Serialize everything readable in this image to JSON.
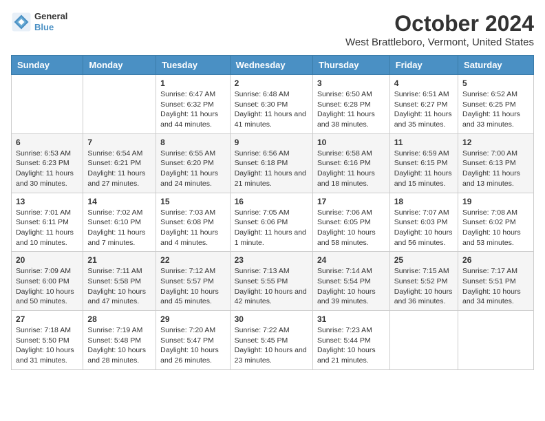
{
  "logo": {
    "line1": "General",
    "line2": "Blue"
  },
  "title": "October 2024",
  "subtitle": "West Brattleboro, Vermont, United States",
  "headers": [
    "Sunday",
    "Monday",
    "Tuesday",
    "Wednesday",
    "Thursday",
    "Friday",
    "Saturday"
  ],
  "weeks": [
    [
      {
        "day": "",
        "sunrise": "",
        "sunset": "",
        "daylight": ""
      },
      {
        "day": "",
        "sunrise": "",
        "sunset": "",
        "daylight": ""
      },
      {
        "day": "1",
        "sunrise": "Sunrise: 6:47 AM",
        "sunset": "Sunset: 6:32 PM",
        "daylight": "Daylight: 11 hours and 44 minutes."
      },
      {
        "day": "2",
        "sunrise": "Sunrise: 6:48 AM",
        "sunset": "Sunset: 6:30 PM",
        "daylight": "Daylight: 11 hours and 41 minutes."
      },
      {
        "day": "3",
        "sunrise": "Sunrise: 6:50 AM",
        "sunset": "Sunset: 6:28 PM",
        "daylight": "Daylight: 11 hours and 38 minutes."
      },
      {
        "day": "4",
        "sunrise": "Sunrise: 6:51 AM",
        "sunset": "Sunset: 6:27 PM",
        "daylight": "Daylight: 11 hours and 35 minutes."
      },
      {
        "day": "5",
        "sunrise": "Sunrise: 6:52 AM",
        "sunset": "Sunset: 6:25 PM",
        "daylight": "Daylight: 11 hours and 33 minutes."
      }
    ],
    [
      {
        "day": "6",
        "sunrise": "Sunrise: 6:53 AM",
        "sunset": "Sunset: 6:23 PM",
        "daylight": "Daylight: 11 hours and 30 minutes."
      },
      {
        "day": "7",
        "sunrise": "Sunrise: 6:54 AM",
        "sunset": "Sunset: 6:21 PM",
        "daylight": "Daylight: 11 hours and 27 minutes."
      },
      {
        "day": "8",
        "sunrise": "Sunrise: 6:55 AM",
        "sunset": "Sunset: 6:20 PM",
        "daylight": "Daylight: 11 hours and 24 minutes."
      },
      {
        "day": "9",
        "sunrise": "Sunrise: 6:56 AM",
        "sunset": "Sunset: 6:18 PM",
        "daylight": "Daylight: 11 hours and 21 minutes."
      },
      {
        "day": "10",
        "sunrise": "Sunrise: 6:58 AM",
        "sunset": "Sunset: 6:16 PM",
        "daylight": "Daylight: 11 hours and 18 minutes."
      },
      {
        "day": "11",
        "sunrise": "Sunrise: 6:59 AM",
        "sunset": "Sunset: 6:15 PM",
        "daylight": "Daylight: 11 hours and 15 minutes."
      },
      {
        "day": "12",
        "sunrise": "Sunrise: 7:00 AM",
        "sunset": "Sunset: 6:13 PM",
        "daylight": "Daylight: 11 hours and 13 minutes."
      }
    ],
    [
      {
        "day": "13",
        "sunrise": "Sunrise: 7:01 AM",
        "sunset": "Sunset: 6:11 PM",
        "daylight": "Daylight: 11 hours and 10 minutes."
      },
      {
        "day": "14",
        "sunrise": "Sunrise: 7:02 AM",
        "sunset": "Sunset: 6:10 PM",
        "daylight": "Daylight: 11 hours and 7 minutes."
      },
      {
        "day": "15",
        "sunrise": "Sunrise: 7:03 AM",
        "sunset": "Sunset: 6:08 PM",
        "daylight": "Daylight: 11 hours and 4 minutes."
      },
      {
        "day": "16",
        "sunrise": "Sunrise: 7:05 AM",
        "sunset": "Sunset: 6:06 PM",
        "daylight": "Daylight: 11 hours and 1 minute."
      },
      {
        "day": "17",
        "sunrise": "Sunrise: 7:06 AM",
        "sunset": "Sunset: 6:05 PM",
        "daylight": "Daylight: 10 hours and 58 minutes."
      },
      {
        "day": "18",
        "sunrise": "Sunrise: 7:07 AM",
        "sunset": "Sunset: 6:03 PM",
        "daylight": "Daylight: 10 hours and 56 minutes."
      },
      {
        "day": "19",
        "sunrise": "Sunrise: 7:08 AM",
        "sunset": "Sunset: 6:02 PM",
        "daylight": "Daylight: 10 hours and 53 minutes."
      }
    ],
    [
      {
        "day": "20",
        "sunrise": "Sunrise: 7:09 AM",
        "sunset": "Sunset: 6:00 PM",
        "daylight": "Daylight: 10 hours and 50 minutes."
      },
      {
        "day": "21",
        "sunrise": "Sunrise: 7:11 AM",
        "sunset": "Sunset: 5:58 PM",
        "daylight": "Daylight: 10 hours and 47 minutes."
      },
      {
        "day": "22",
        "sunrise": "Sunrise: 7:12 AM",
        "sunset": "Sunset: 5:57 PM",
        "daylight": "Daylight: 10 hours and 45 minutes."
      },
      {
        "day": "23",
        "sunrise": "Sunrise: 7:13 AM",
        "sunset": "Sunset: 5:55 PM",
        "daylight": "Daylight: 10 hours and 42 minutes."
      },
      {
        "day": "24",
        "sunrise": "Sunrise: 7:14 AM",
        "sunset": "Sunset: 5:54 PM",
        "daylight": "Daylight: 10 hours and 39 minutes."
      },
      {
        "day": "25",
        "sunrise": "Sunrise: 7:15 AM",
        "sunset": "Sunset: 5:52 PM",
        "daylight": "Daylight: 10 hours and 36 minutes."
      },
      {
        "day": "26",
        "sunrise": "Sunrise: 7:17 AM",
        "sunset": "Sunset: 5:51 PM",
        "daylight": "Daylight: 10 hours and 34 minutes."
      }
    ],
    [
      {
        "day": "27",
        "sunrise": "Sunrise: 7:18 AM",
        "sunset": "Sunset: 5:50 PM",
        "daylight": "Daylight: 10 hours and 31 minutes."
      },
      {
        "day": "28",
        "sunrise": "Sunrise: 7:19 AM",
        "sunset": "Sunset: 5:48 PM",
        "daylight": "Daylight: 10 hours and 28 minutes."
      },
      {
        "day": "29",
        "sunrise": "Sunrise: 7:20 AM",
        "sunset": "Sunset: 5:47 PM",
        "daylight": "Daylight: 10 hours and 26 minutes."
      },
      {
        "day": "30",
        "sunrise": "Sunrise: 7:22 AM",
        "sunset": "Sunset: 5:45 PM",
        "daylight": "Daylight: 10 hours and 23 minutes."
      },
      {
        "day": "31",
        "sunrise": "Sunrise: 7:23 AM",
        "sunset": "Sunset: 5:44 PM",
        "daylight": "Daylight: 10 hours and 21 minutes."
      },
      {
        "day": "",
        "sunrise": "",
        "sunset": "",
        "daylight": ""
      },
      {
        "day": "",
        "sunrise": "",
        "sunset": "",
        "daylight": ""
      }
    ]
  ]
}
